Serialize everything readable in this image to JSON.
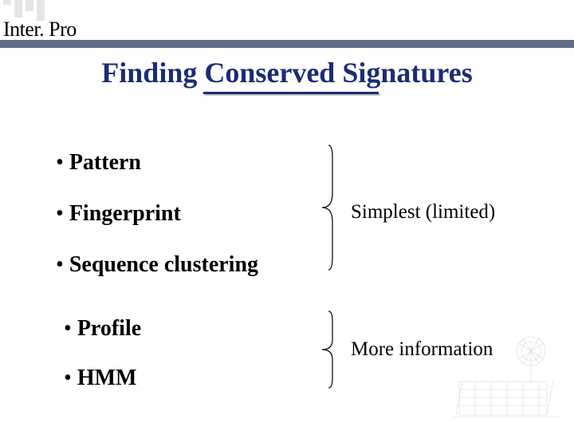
{
  "logo_text": "Inter. Pro",
  "title": "Finding Conserved Signatures",
  "group1": {
    "items": [
      "Pattern",
      "Fingerprint",
      "Sequence clustering"
    ],
    "label": "Simplest (limited)"
  },
  "group2": {
    "items": [
      "Profile",
      "HMM"
    ],
    "label": "More information"
  }
}
